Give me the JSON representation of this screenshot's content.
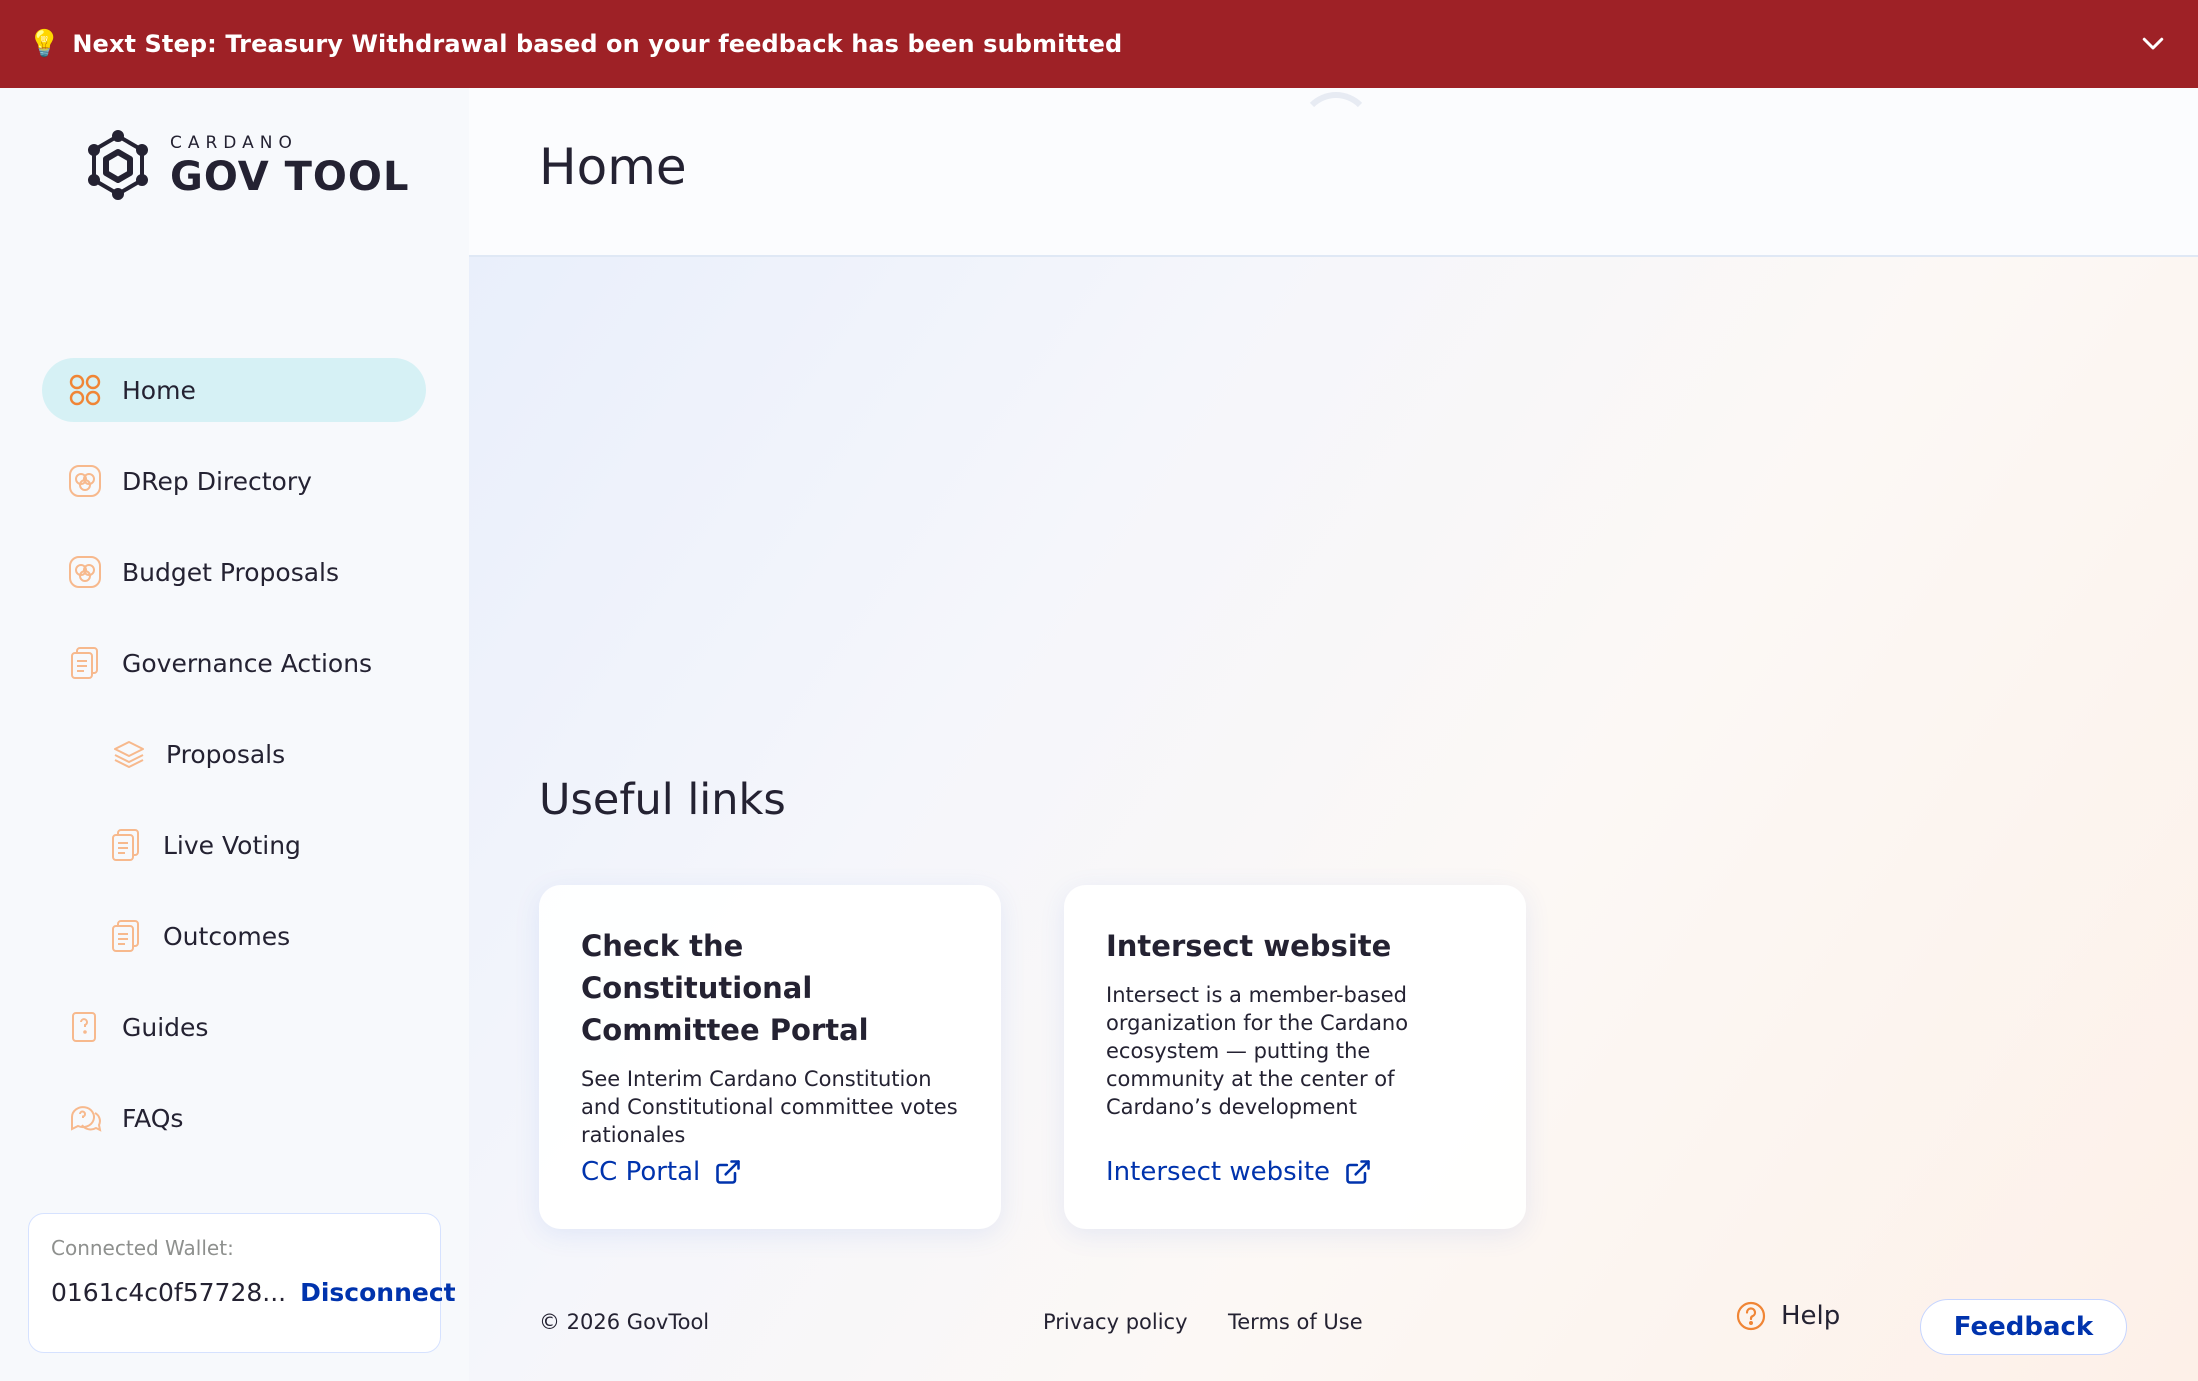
{
  "banner": {
    "icon": "lightbulb-icon",
    "message": "Next Step: Treasury Withdrawal based on your feedback has been submitted",
    "color": "#9e2126"
  },
  "logo": {
    "small": "CARDANO",
    "big": "GOV TOOL"
  },
  "nav": {
    "items": [
      {
        "label": "Home",
        "icon": "grid-icon",
        "active": true
      },
      {
        "label": "DRep Directory",
        "icon": "drep-icon"
      },
      {
        "label": "Budget Proposals",
        "icon": "budget-icon"
      },
      {
        "label": "Governance Actions",
        "icon": "document-icon"
      },
      {
        "label": "Proposals",
        "icon": "stack-icon"
      },
      {
        "label": "Live Voting",
        "icon": "document-icon"
      },
      {
        "label": "Outcomes",
        "icon": "document-icon"
      },
      {
        "label": "Guides",
        "icon": "guide-icon"
      },
      {
        "label": "FAQs",
        "icon": "faq-icon"
      }
    ]
  },
  "wallet": {
    "caption": "Connected Wallet:",
    "address": "0161c4c0f57728...",
    "disconnect_label": "Disconnect"
  },
  "header": {
    "title": "Home"
  },
  "main": {
    "section_title": "Useful links",
    "cards": [
      {
        "title": "Check the Constitutional Committee Portal",
        "description": "See Interim Cardano Constitution and Constitutional committee votes rationales",
        "link_label": "CC Portal"
      },
      {
        "title": "Intersect website",
        "description": "Intersect is a member-based organization for the Cardano ecosystem — putting the community at the center of Cardano’s development",
        "link_label": "Intersect website"
      }
    ]
  },
  "footer": {
    "copyright": "© 2026 GovTool",
    "privacy_label": "Privacy policy",
    "terms_label": "Terms of Use",
    "help_label": "Help",
    "feedback_label": "Feedback"
  },
  "colors": {
    "accent_orange": "#f08535",
    "link_blue": "#0033ad",
    "active_nav": "#d6f1f5"
  }
}
